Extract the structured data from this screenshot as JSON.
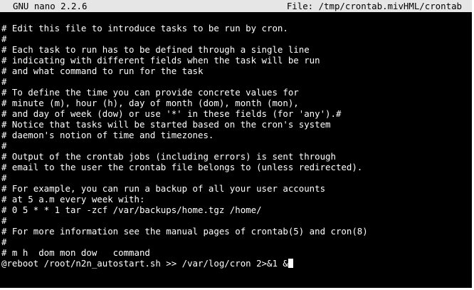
{
  "editor": {
    "app_title": "GNU nano 2.2.6",
    "file_label": "File: /tmp/crontab.mivHML/crontab"
  },
  "colors": {
    "background": "#000000",
    "text": "#ffffff",
    "titlebar_background": "#e6e6e6",
    "titlebar_text": "#000000"
  },
  "lines": [
    "# Edit this file to introduce tasks to be run by cron.",
    "#",
    "# Each task to run has to be defined through a single line",
    "# indicating with different fields when the task will be run",
    "# and what command to run for the task",
    "#",
    "# To define the time you can provide concrete values for",
    "# minute (m), hour (h), day of month (dom), month (mon),",
    "# and day of week (dow) or use '*' in these fields (for 'any').#",
    "# Notice that tasks will be started based on the cron's system",
    "# daemon's notion of time and timezones.",
    "#",
    "# Output of the crontab jobs (including errors) is sent through",
    "# email to the user the crontab file belongs to (unless redirected).",
    "#",
    "# For example, you can run a backup of all your user accounts",
    "# at 5 a.m every week with:",
    "# 0 5 * * 1 tar -zcf /var/backups/home.tgz /home/",
    "#",
    "# For more information see the manual pages of crontab(5) and cron(8)",
    "#",
    "# m h  dom mon dow   command",
    "@reboot /root/n2n_autostart.sh >> /var/log/cron 2>&1 &"
  ]
}
